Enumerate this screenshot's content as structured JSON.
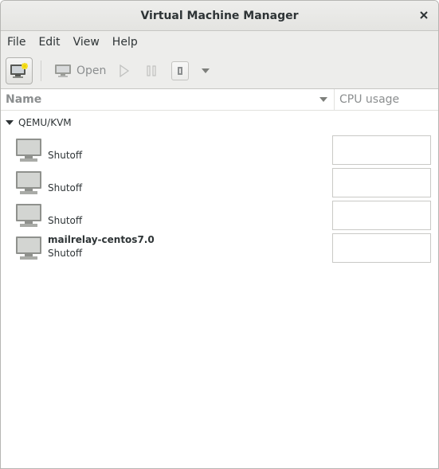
{
  "window": {
    "title": "Virtual Machine Manager"
  },
  "menubar": {
    "items": [
      "File",
      "Edit",
      "View",
      "Help"
    ]
  },
  "toolbar": {
    "open_label": "Open"
  },
  "columns": {
    "name": "Name",
    "cpu": "CPU usage"
  },
  "group": {
    "label": "QEMU/KVM"
  },
  "vms": [
    {
      "name": "",
      "status": "Shutoff"
    },
    {
      "name": "",
      "status": "Shutoff"
    },
    {
      "name": "",
      "status": "Shutoff"
    },
    {
      "name": "mailrelay-centos7.0",
      "status": "Shutoff"
    }
  ],
  "colors": {
    "disabled_text": "#8b8e8f",
    "border": "#c9c9c6",
    "chrome": "#ededeb"
  }
}
